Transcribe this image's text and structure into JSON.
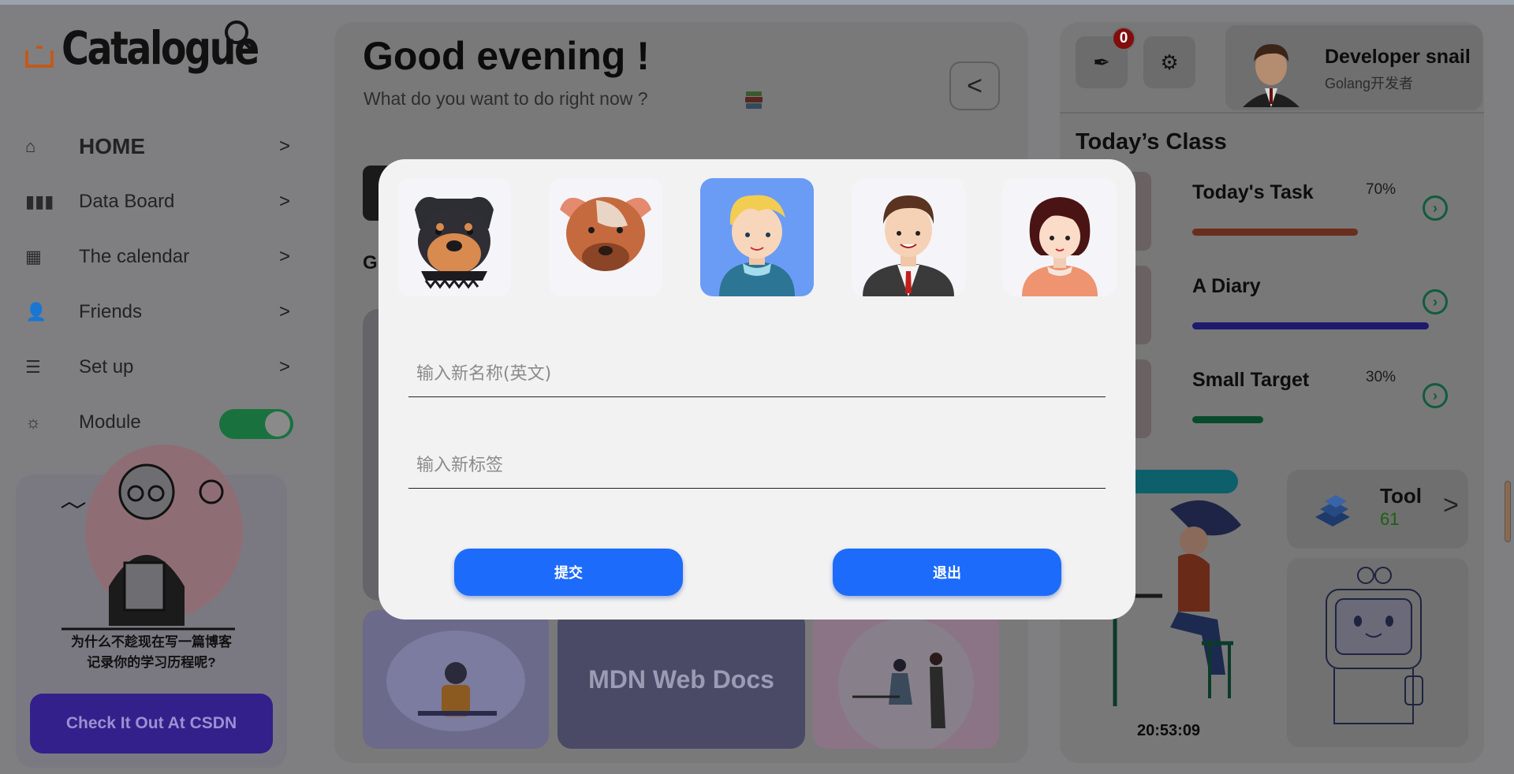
{
  "sidebar": {
    "logo_text": "Catalogue",
    "nav": [
      {
        "label": "HOME",
        "icon": "home-icon",
        "arrow": ">"
      },
      {
        "label": "Data Board",
        "icon": "bar-chart-icon",
        "arrow": ">"
      },
      {
        "label": "The calendar",
        "icon": "calendar-icon",
        "arrow": ">"
      },
      {
        "label": "Friends",
        "icon": "friends-icon",
        "arrow": ">"
      },
      {
        "label": "Set up",
        "icon": "database-icon",
        "arrow": ">"
      },
      {
        "label": "Module",
        "icon": "sun-icon",
        "toggle_on": true
      }
    ],
    "promo": {
      "line1": "为什么不趁现在写一篇博客",
      "line2": "记录你的学习历程呢?",
      "button": "Check It Out At CSDN"
    }
  },
  "main": {
    "greeting": "Good evening !",
    "subtitle": "What do you want to do right now ?",
    "back_button": "<",
    "section_letter": "G",
    "tile_mdn": "MDN Web Docs"
  },
  "right": {
    "notification_count": "0",
    "user_name": "Developer snail",
    "user_tag": "Golang开发者",
    "class_title": "Today’s Class",
    "classes": [
      {
        "name": "Today's Task",
        "percent_label": "70%",
        "bar_color": "#6a2e1c"
      },
      {
        "name": "A Diary",
        "percent_label": "",
        "bar_color": "#1e1a6e"
      },
      {
        "name": "Small Target",
        "percent_label": "30%",
        "bar_color": "#0a4a2c"
      }
    ],
    "clock": "20:53:09",
    "tool_name": "Tool",
    "tool_count": "61",
    "tool_arrow": ">"
  },
  "modal": {
    "avatars": [
      "rottweiler-avatar",
      "bulldog-avatar",
      "blond-boy-avatar",
      "businessman-avatar",
      "girl-avatar"
    ],
    "selected_avatar": "blond-boy-avatar",
    "name_placeholder": "输入新名称(英文)",
    "tag_placeholder": "输入新标签",
    "submit_label": "提交",
    "exit_label": "退出"
  },
  "colors": {
    "accent_blue": "#1d6bfa",
    "selected_avatar_bg": "#6a9cf5",
    "promo_button": "#33208a",
    "badge": "#820d0d"
  }
}
